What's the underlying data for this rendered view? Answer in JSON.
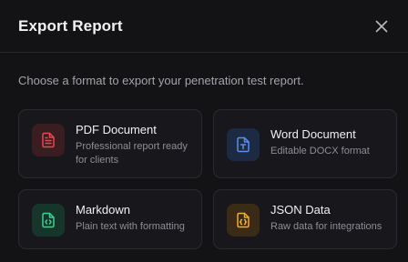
{
  "dialog": {
    "title": "Export Report",
    "subtitle": "Choose a format to export your penetration test report."
  },
  "formats": [
    {
      "title": "PDF Document",
      "description": "Professional report ready for clients",
      "icon": "file-text-icon",
      "color": "#e5484d",
      "bg": "#3a1d21"
    },
    {
      "title": "Word Document",
      "description": "Editable DOCX format",
      "icon": "file-type-icon",
      "color": "#5b8cf0",
      "bg": "#1d2a44"
    },
    {
      "title": "Markdown",
      "description": "Plain text with formatting",
      "icon": "file-code-icon",
      "color": "#3fcf8e",
      "bg": "#17362b"
    },
    {
      "title": "JSON Data",
      "description": "Raw data for integrations",
      "icon": "file-json-icon",
      "color": "#f0a93b",
      "bg": "#3a2b16"
    }
  ]
}
